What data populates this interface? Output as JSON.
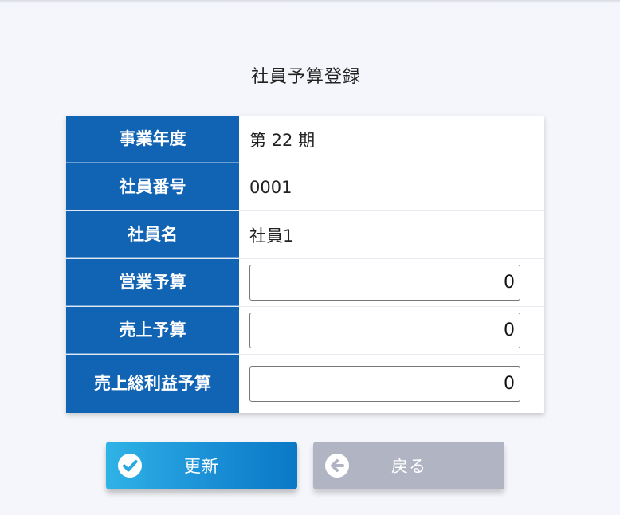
{
  "page": {
    "title": "社員予算登録"
  },
  "form": {
    "rows": [
      {
        "label": "事業年度",
        "value": "第 22 期"
      },
      {
        "label": "社員番号",
        "value": "0001"
      },
      {
        "label": "社員名",
        "value": "社員1"
      },
      {
        "label": "営業予算",
        "input_value": "0"
      },
      {
        "label": "売上予算",
        "input_value": "0"
      },
      {
        "label": "売上総利益予算",
        "input_value": "0"
      }
    ]
  },
  "buttons": {
    "update_label": "更新",
    "update_icon": "check-circle-icon",
    "back_label": "戻る",
    "back_icon": "arrow-left-circle-icon"
  },
  "colors": {
    "label_background": "#1163b3",
    "update_button": "#1a8fd6",
    "back_button": "#b1b5c3",
    "page_background": "#f4f6fb"
  }
}
